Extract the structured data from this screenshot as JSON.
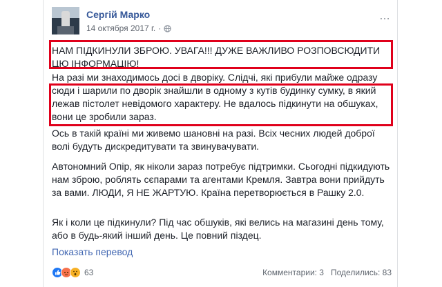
{
  "post": {
    "author": "Сергій Марко",
    "date": "14 октября 2017 г.",
    "date_sep": "·",
    "more_icon": "…",
    "paragraphs": [
      "НАМ ПІДКИНУЛИ ЗБРОЮ. УВАГА!!! ДУЖЕ ВАЖЛИВО РОЗПОВСЮДИТИ ЦЮ ІНФОРМАЦІЮ!",
      "На разі ми знаходимось досі в дворіку. Слідчі, які прибули майже одразу сюди і шарили по дворік знайшли в одному з кутів будинку сумку, в який лежав пістолет невідомого характеру. Не вдалось підкинути на обшуках, вони це зробили зараз.",
      "Ось в такій країні ми живемо шановні на разі. Всіх чесних людей доброї волі будуть дискредитувати та звинувачувати.",
      "Автономний Опір, як ніколи зараз потребує підтримки. Сьогодні підкидують нам зброю, роблять сєпарами та агентами Кремля. Завтра вони прийдуть за вами. ЛЮДИ, Я НЕ ЖАРТУЮ. Країна перетворюється в Рашку 2.0.",
      "Як і коли це підкинули? Під час обшуків, які велись на магазині день тому, або в будь-який інший день. Це повний піздец."
    ],
    "translate_link": "Показать перевод",
    "reaction_count": "63",
    "reaction_icons": [
      "like-icon",
      "angry-icon",
      "wow-icon"
    ],
    "comments": "Комментарии: 3",
    "shares": "Поделились: 83"
  },
  "colors": {
    "author": "#365899",
    "link": "#4267b2",
    "highlight": "#e0001b"
  }
}
